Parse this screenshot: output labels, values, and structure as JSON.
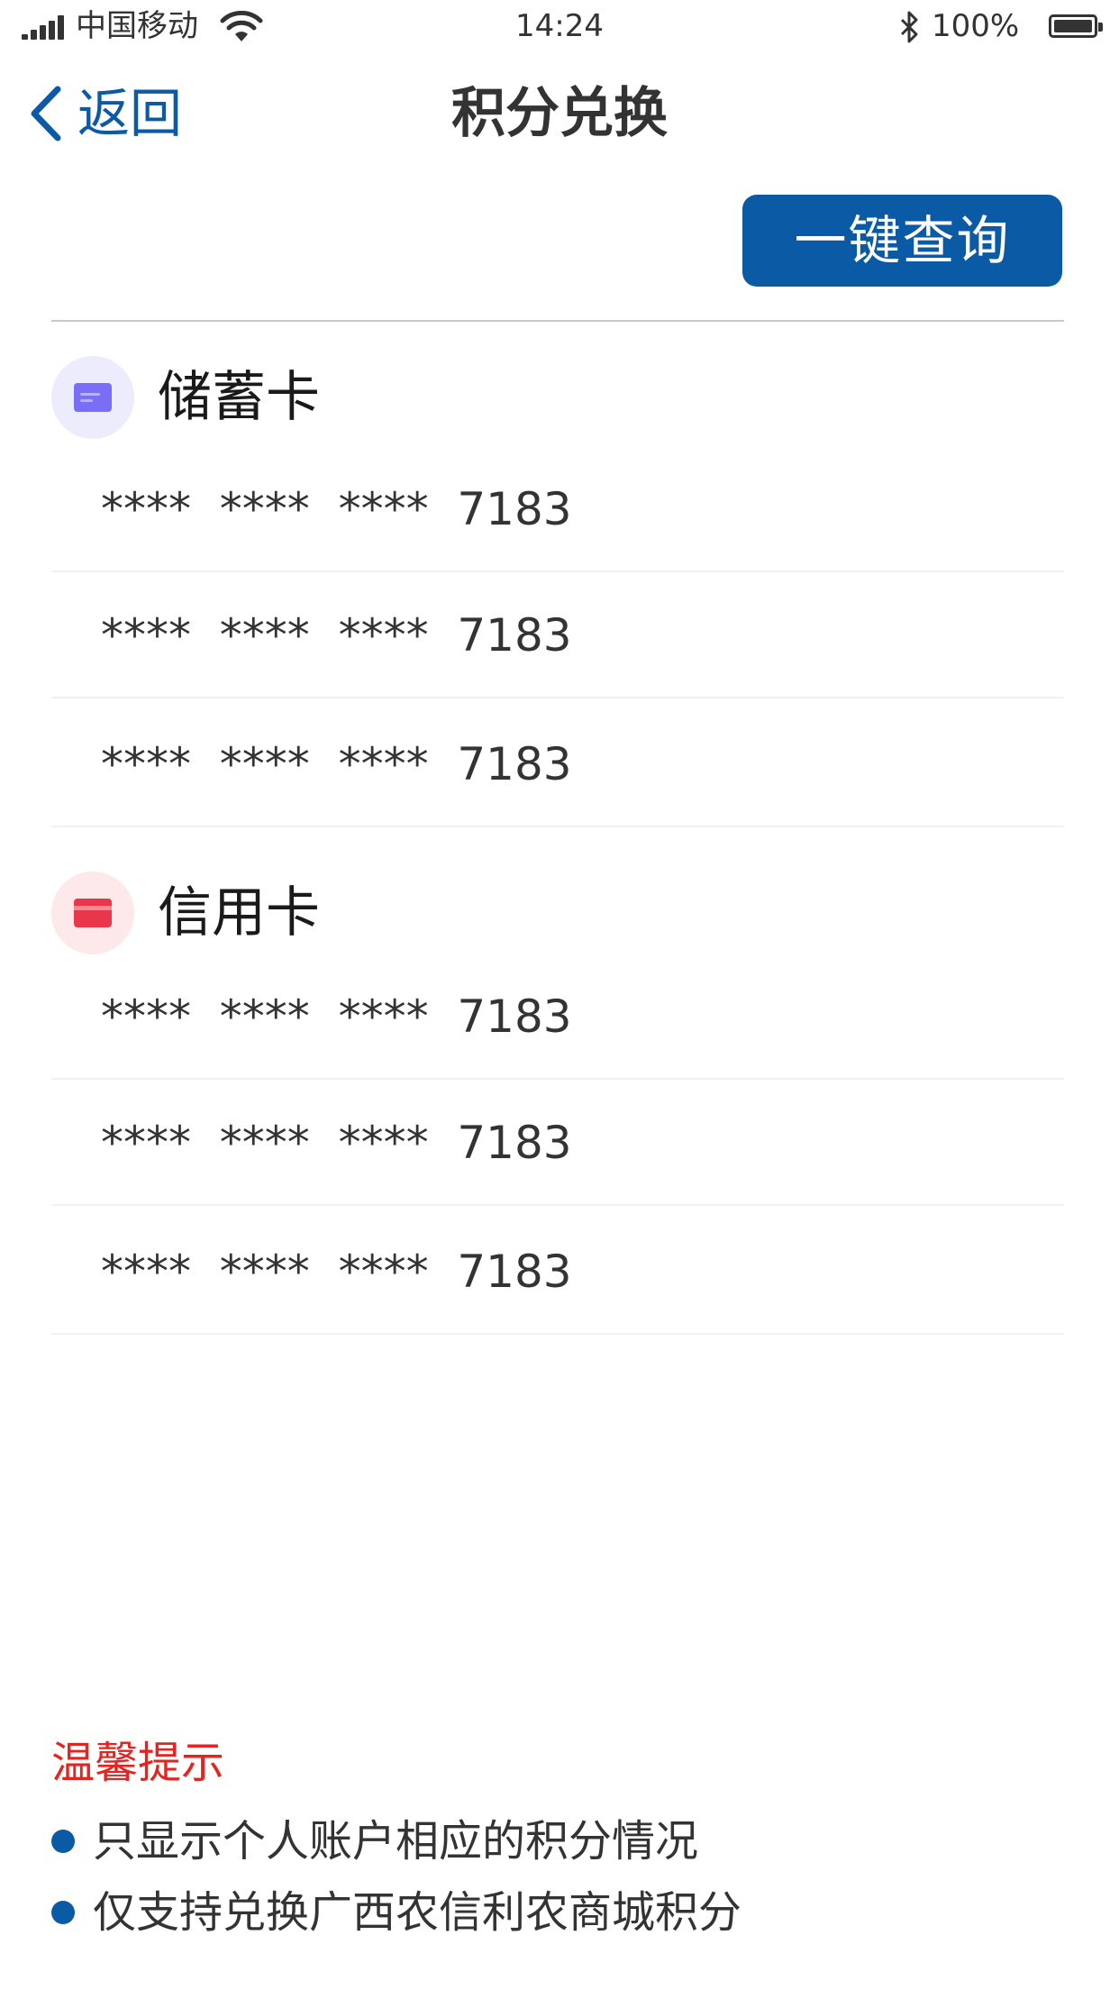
{
  "status_bar": {
    "carrier": "中国移动",
    "time": "14:24",
    "battery_percent": "100%"
  },
  "nav": {
    "back_label": "返回",
    "title": "积分兑换"
  },
  "query_button_label": "一键查询",
  "debit_section": {
    "title": "储蓄卡",
    "icon": "debit-card-icon",
    "accent_color": "#7b6ef6",
    "cards": [
      {
        "masked": "****  ****  ****",
        "last4": "7183"
      },
      {
        "masked": "****  ****  ****",
        "last4": "7183"
      },
      {
        "masked": "****  ****  ****",
        "last4": "7183"
      }
    ]
  },
  "credit_section": {
    "title": "信用卡",
    "icon": "credit-card-icon",
    "accent_color": "#e8374a",
    "cards": [
      {
        "masked": "****  ****  ****",
        "last4": "7183"
      },
      {
        "masked": "****  ****  ****",
        "last4": "7183"
      },
      {
        "masked": "****  ****  ****",
        "last4": "7183"
      }
    ]
  },
  "tips": {
    "title": "温馨提示",
    "items": [
      "只显示个人账户相应的积分情况",
      "仅支持兑换广西农信利农商城积分"
    ]
  },
  "colors": {
    "primary": "#0a5aa6",
    "tip_title": "#e8231f"
  }
}
